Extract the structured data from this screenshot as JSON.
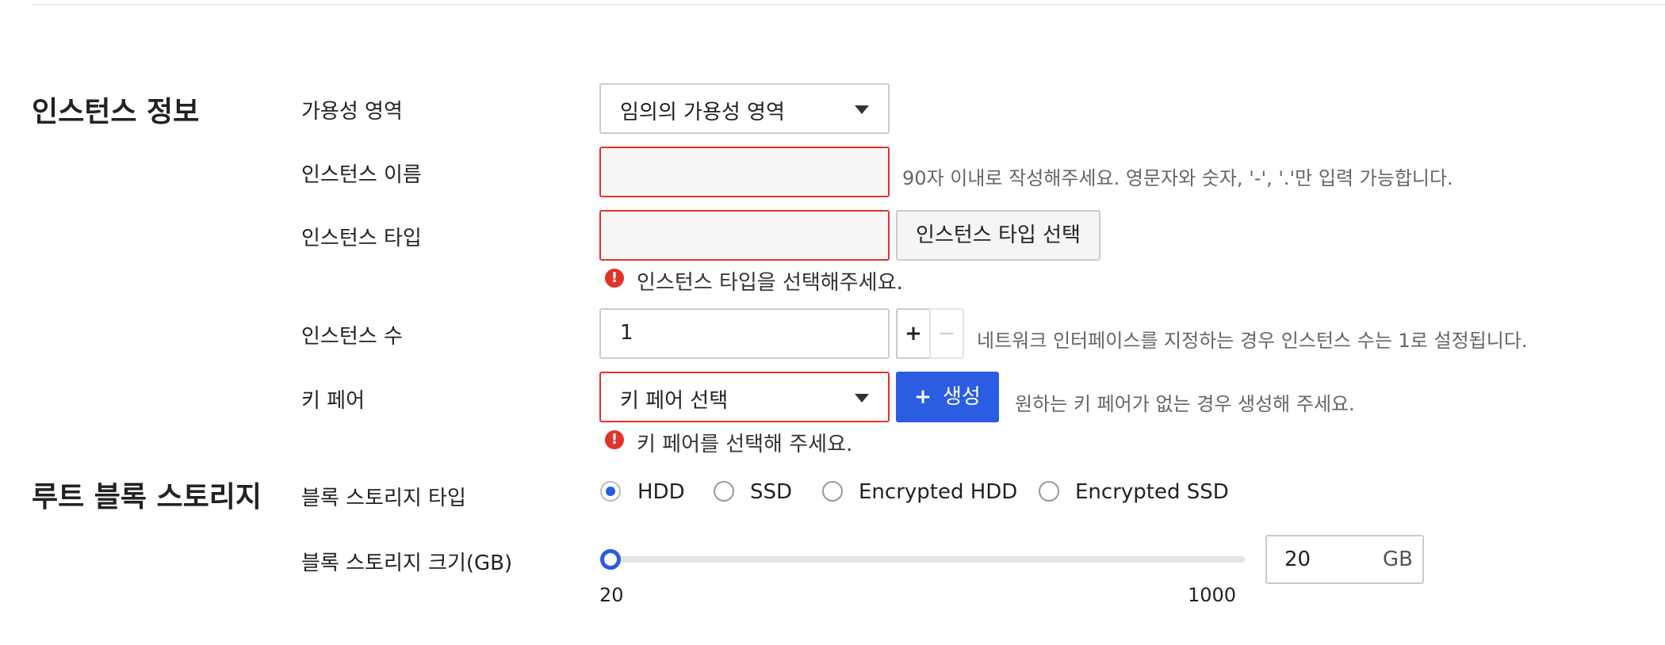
{
  "sections": {
    "instance_info": "인스턴스 정보",
    "root_block_storage": "루트 블록 스토리지"
  },
  "availability_zone": {
    "label": "가용성 영역",
    "value": "임의의 가용성 영역"
  },
  "instance_name": {
    "label": "인스턴스 이름",
    "value": "",
    "hint": "90자 이내로 작성해주세요. 영문자와 숫자, '-', '.'만 입력 가능합니다."
  },
  "instance_type": {
    "label": "인스턴스 타입",
    "value": "",
    "button": "인스턴스 타입 선택",
    "error": "인스턴스 타입을 선택해주세요."
  },
  "instance_count": {
    "label": "인스턴스 수",
    "value": "1",
    "plus": "+",
    "minus": "−",
    "hint": "네트워크 인터페이스를 지정하는 경우 인스턴스 수는 1로 설정됩니다."
  },
  "key_pair": {
    "label": "키 페어",
    "value": "키 페어 선택",
    "create_button": "생성",
    "create_icon": "+",
    "hint": "원하는 키 페어가 없는 경우 생성해 주세요.",
    "error": "키 페어를 선택해 주세요."
  },
  "block_storage_type": {
    "label": "블록 스토리지 타입",
    "options": [
      "HDD",
      "SSD",
      "Encrypted HDD",
      "Encrypted SSD"
    ],
    "selected": "HDD"
  },
  "block_storage_size": {
    "label": "블록 스토리지 크기(GB)",
    "min": "20",
    "max": "1000",
    "value": "20",
    "unit": "GB"
  },
  "error_icon": "!",
  "colors": {
    "accent": "#2b5de3",
    "error": "#e0342a",
    "border": "#cccccc"
  }
}
